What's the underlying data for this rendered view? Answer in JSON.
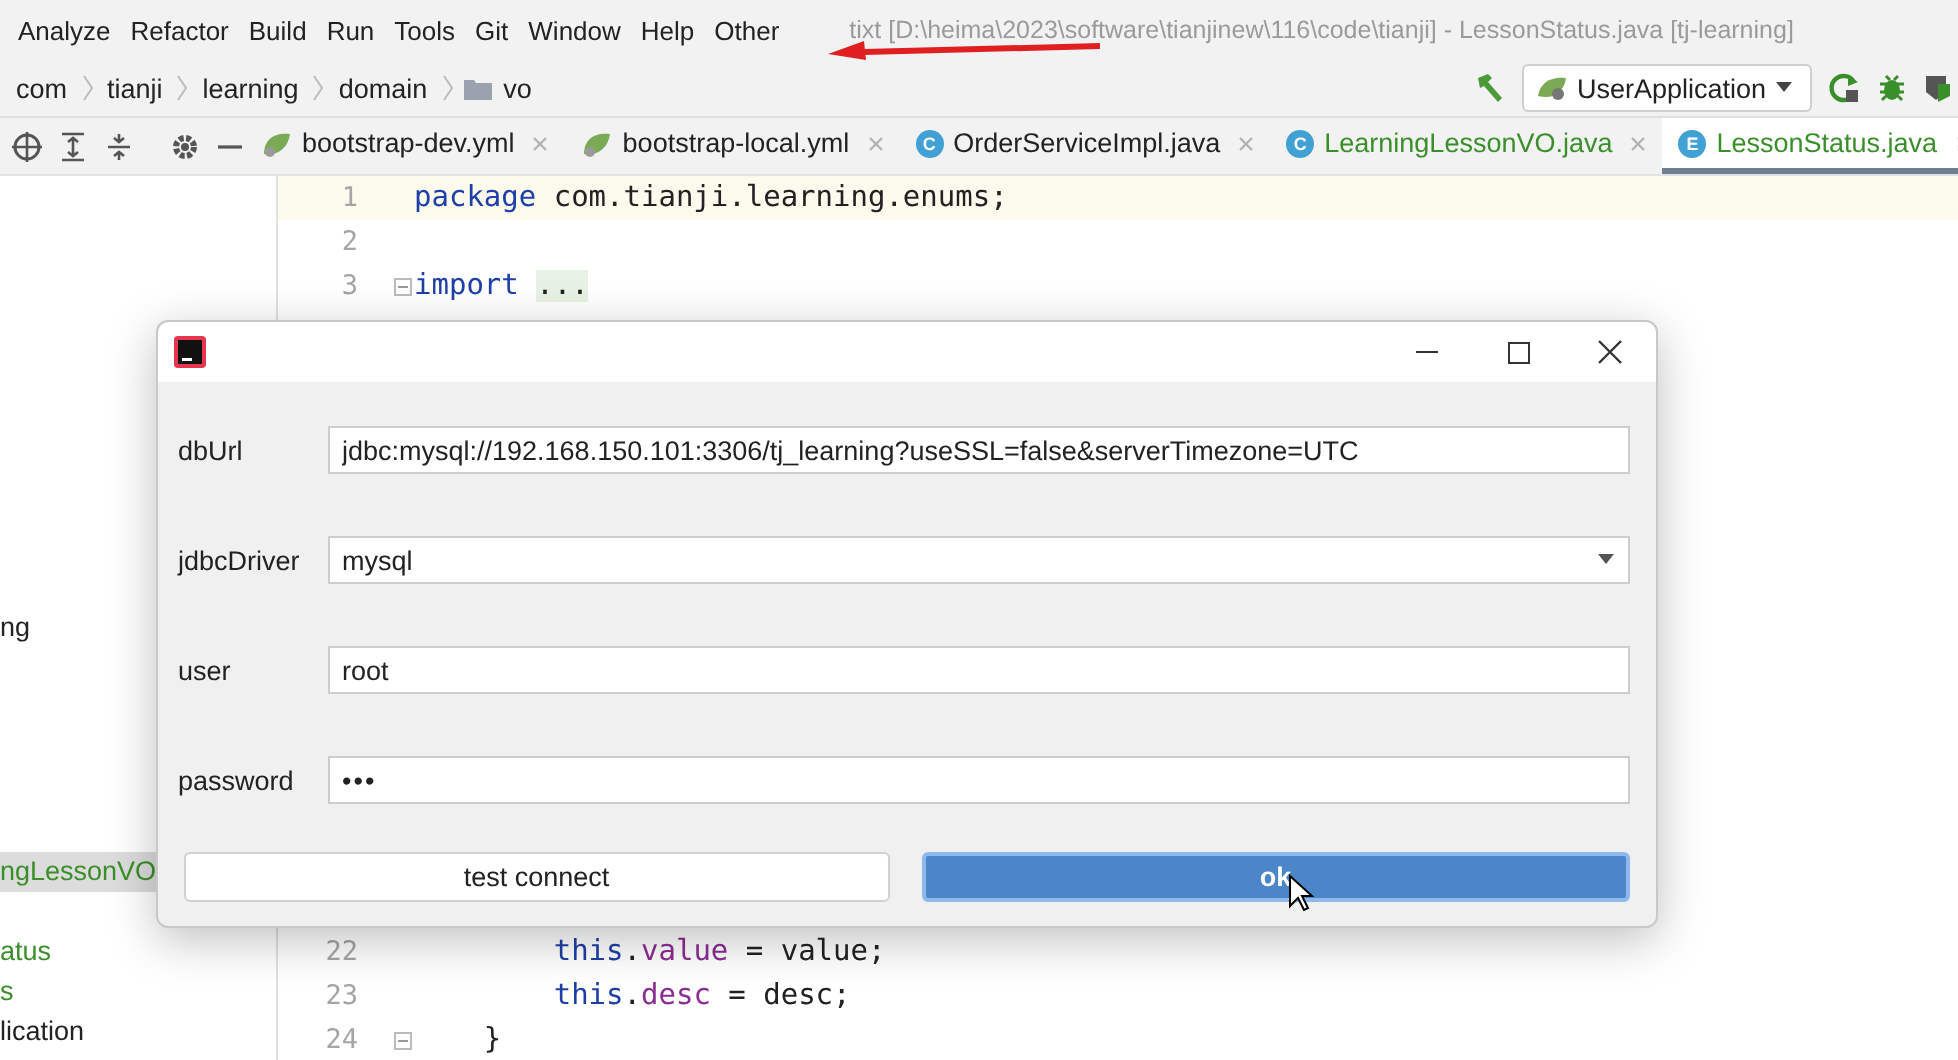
{
  "menu_bar": [
    {
      "label": "Analyze"
    },
    {
      "label": "Refactor"
    },
    {
      "label": "Build"
    },
    {
      "label": "Run"
    },
    {
      "label": "Tools"
    },
    {
      "label": "Git"
    },
    {
      "label": "Window"
    },
    {
      "label": "Help"
    },
    {
      "label": "Other"
    }
  ],
  "window_title": "tixt [D:\\heima\\2023\\software\\tianjinew\\116\\code\\tianji] - LessonStatus.java [tj-learning]",
  "breadcrumb": [
    {
      "label": "com",
      "kind": "package"
    },
    {
      "label": "tianji",
      "kind": "package"
    },
    {
      "label": "learning",
      "kind": "package"
    },
    {
      "label": "domain",
      "kind": "package"
    },
    {
      "label": "vo",
      "kind": "folder"
    }
  ],
  "run_config": {
    "label": "UserApplication"
  },
  "tabs": [
    {
      "label": "bootstrap-dev.yml",
      "kind": "yml",
      "added": false,
      "selected": false
    },
    {
      "label": "bootstrap-local.yml",
      "kind": "yml",
      "added": false,
      "selected": false
    },
    {
      "label": "OrderServiceImpl.java",
      "kind": "class",
      "icon_letter": "C",
      "added": false,
      "selected": false
    },
    {
      "label": "LearningLessonVO.java",
      "kind": "class",
      "icon_letter": "C",
      "added": true,
      "selected": false
    },
    {
      "label": "LessonStatus.java",
      "kind": "enum",
      "icon_letter": "E",
      "added": true,
      "selected": true
    }
  ],
  "sidebar": {
    "items": [
      {
        "label": "ng",
        "added": false,
        "selected": false
      },
      {
        "label": "ngLessonVO",
        "added": true,
        "selected": true
      },
      {
        "label": "atus",
        "added": true,
        "selected": false
      },
      {
        "label": "s",
        "added": true,
        "selected": false
      },
      {
        "label": "lication",
        "added": false,
        "selected": false
      }
    ]
  },
  "code_top": [
    {
      "number": "1",
      "current": true,
      "folded": false,
      "tokens": [
        {
          "kind": "keyword",
          "text": "package"
        },
        {
          "kind": "plain",
          "text": " com.tianji.learning.enums;"
        }
      ]
    },
    {
      "number": "2",
      "current": false,
      "folded": false
    },
    {
      "number": "3",
      "current": false,
      "folded": true,
      "tokens": [
        {
          "kind": "keyword",
          "text": "import "
        },
        {
          "kind": "folded",
          "text": "..."
        }
      ]
    }
  ],
  "code_bottom": [
    {
      "number": "22",
      "current": false,
      "folded": false,
      "tokens": [
        {
          "kind": "keyword",
          "text": "        this"
        },
        {
          "kind": "plain",
          "text": "."
        },
        {
          "kind": "field",
          "text": "value"
        },
        {
          "kind": "plain",
          "text": " = value;"
        }
      ]
    },
    {
      "number": "23",
      "current": false,
      "folded": false,
      "tokens": [
        {
          "kind": "keyword",
          "text": "        this"
        },
        {
          "kind": "plain",
          "text": "."
        },
        {
          "kind": "field",
          "text": "desc"
        },
        {
          "kind": "plain",
          "text": " = desc;"
        }
      ]
    },
    {
      "number": "24",
      "current": false,
      "folded": true,
      "tokens": [
        {
          "kind": "plain",
          "text": "    }"
        }
      ]
    }
  ],
  "dialog": {
    "fields": [
      {
        "label": "dbUrl",
        "kind": "text",
        "value": "jdbc:mysql://192.168.150.101:3306/tj_learning?useSSL=false&serverTimezone=UTC"
      },
      {
        "label": "jdbcDriver",
        "kind": "dropdown",
        "value": "mysql"
      },
      {
        "label": "user",
        "kind": "text",
        "value": "root"
      },
      {
        "label": "password",
        "kind": "password",
        "value": "•••"
      }
    ],
    "buttons": [
      {
        "label": "test connect",
        "primary": false
      },
      {
        "label": "ok",
        "primary": true
      }
    ]
  }
}
